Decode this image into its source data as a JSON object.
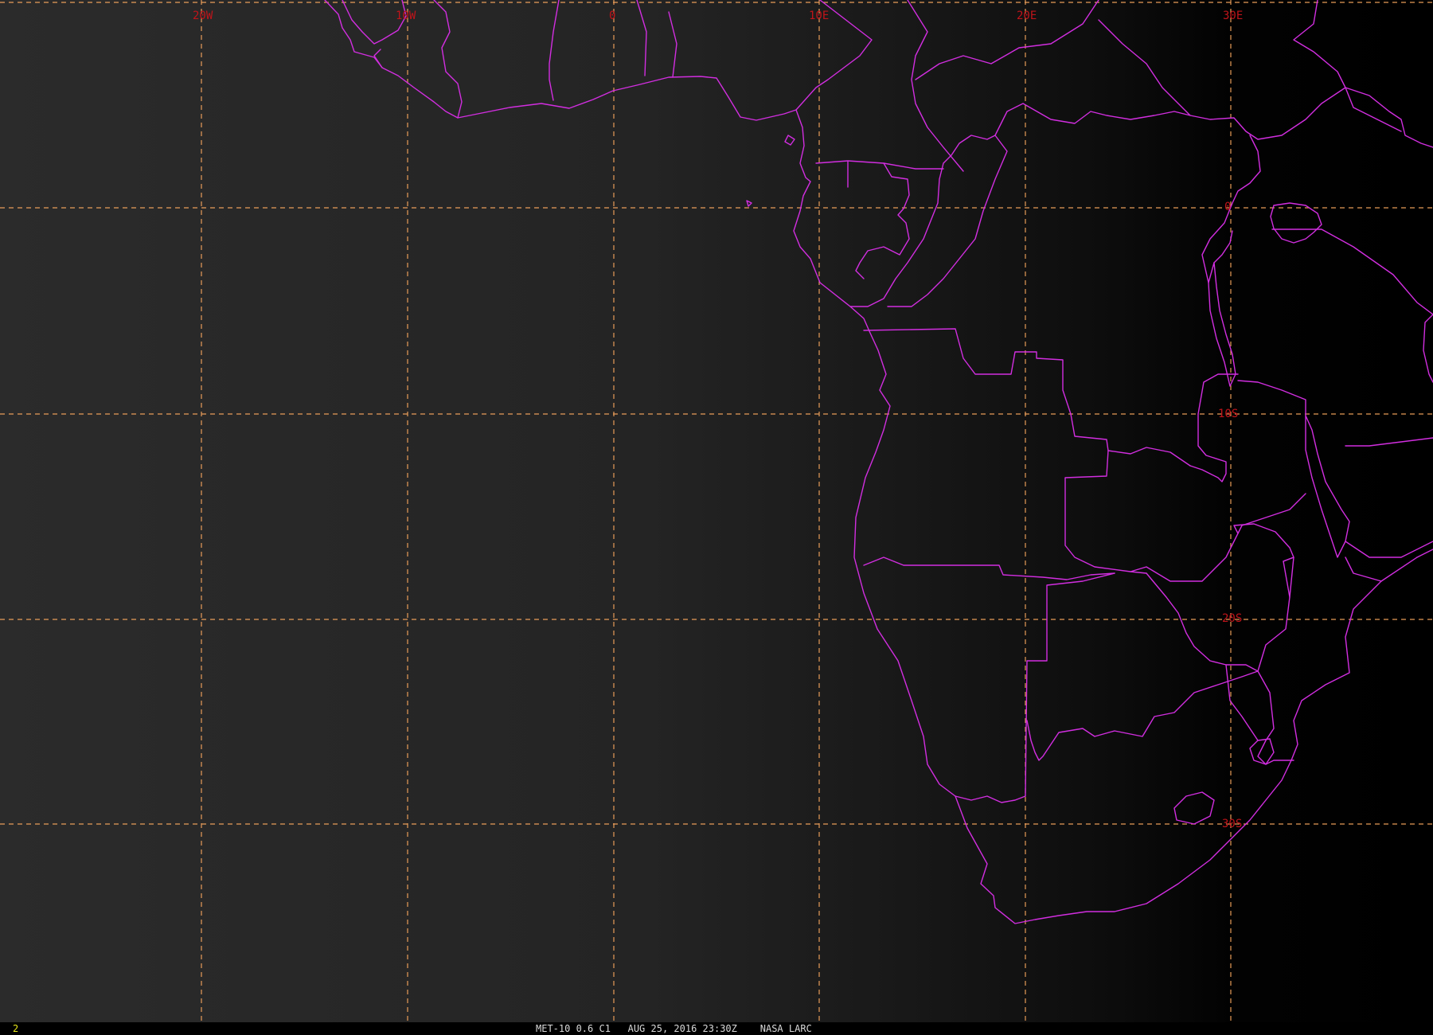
{
  "map": {
    "longitude_labels": [
      "20W",
      "10W",
      "0",
      "10E",
      "20E",
      "30E"
    ],
    "latitude_labels": [
      "0",
      "10S",
      "20S",
      "30S"
    ],
    "colors": {
      "background_left": "#2a2a2a",
      "background_right": "#000000",
      "grid": "#f3a35c",
      "grid_label": "#c0141a",
      "borders": "#d22ee0",
      "frame_number": "#e6e61a",
      "caption": "#d9d9d9"
    }
  },
  "status": {
    "frame_number": "2",
    "caption": "MET-10 0.6 C1   AUG 25, 2016 23:30Z    NASA LARC"
  }
}
